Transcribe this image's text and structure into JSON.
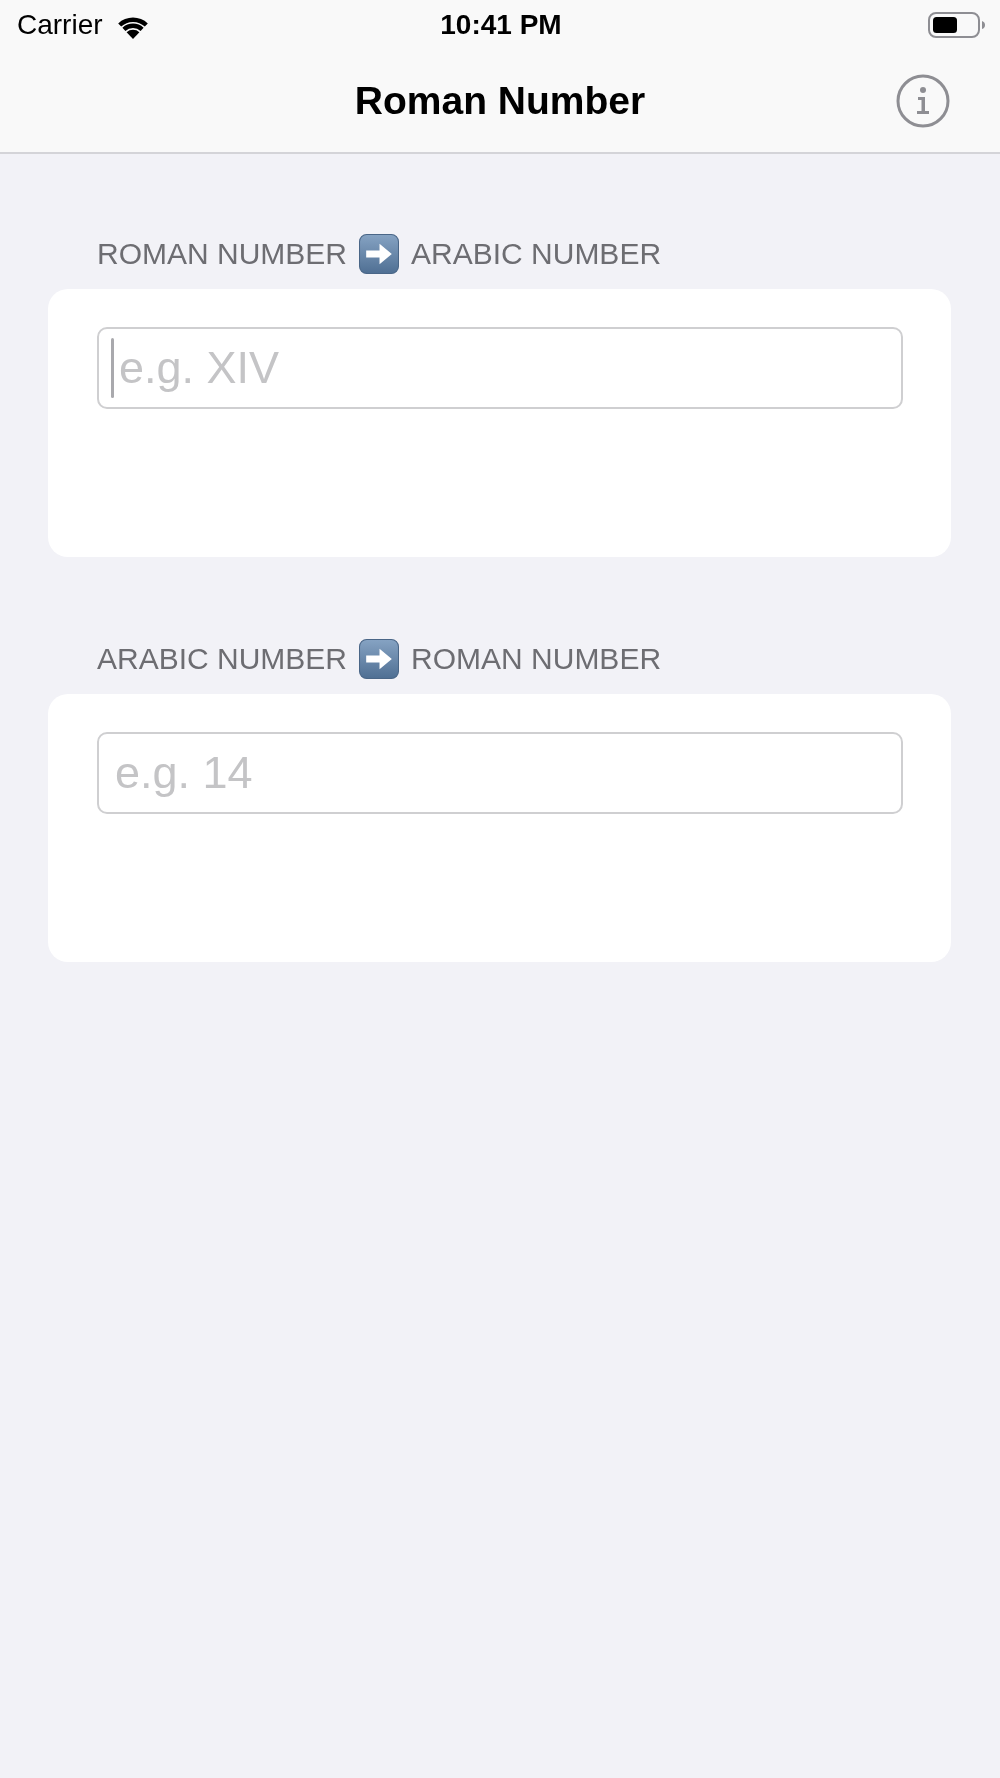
{
  "status_bar": {
    "carrier": "Carrier",
    "time": "10:41 PM"
  },
  "nav_bar": {
    "title": "Roman Number"
  },
  "sections": [
    {
      "from": "ROMAN NUMBER",
      "to": "ARABIC NUMBER",
      "field": {
        "placeholder": "e.g. XIV",
        "focused": true
      }
    },
    {
      "from": "ARABIC NUMBER",
      "to": "ROMAN NUMBER",
      "field": {
        "placeholder": "e.g. 14",
        "focused": false
      }
    }
  ]
}
